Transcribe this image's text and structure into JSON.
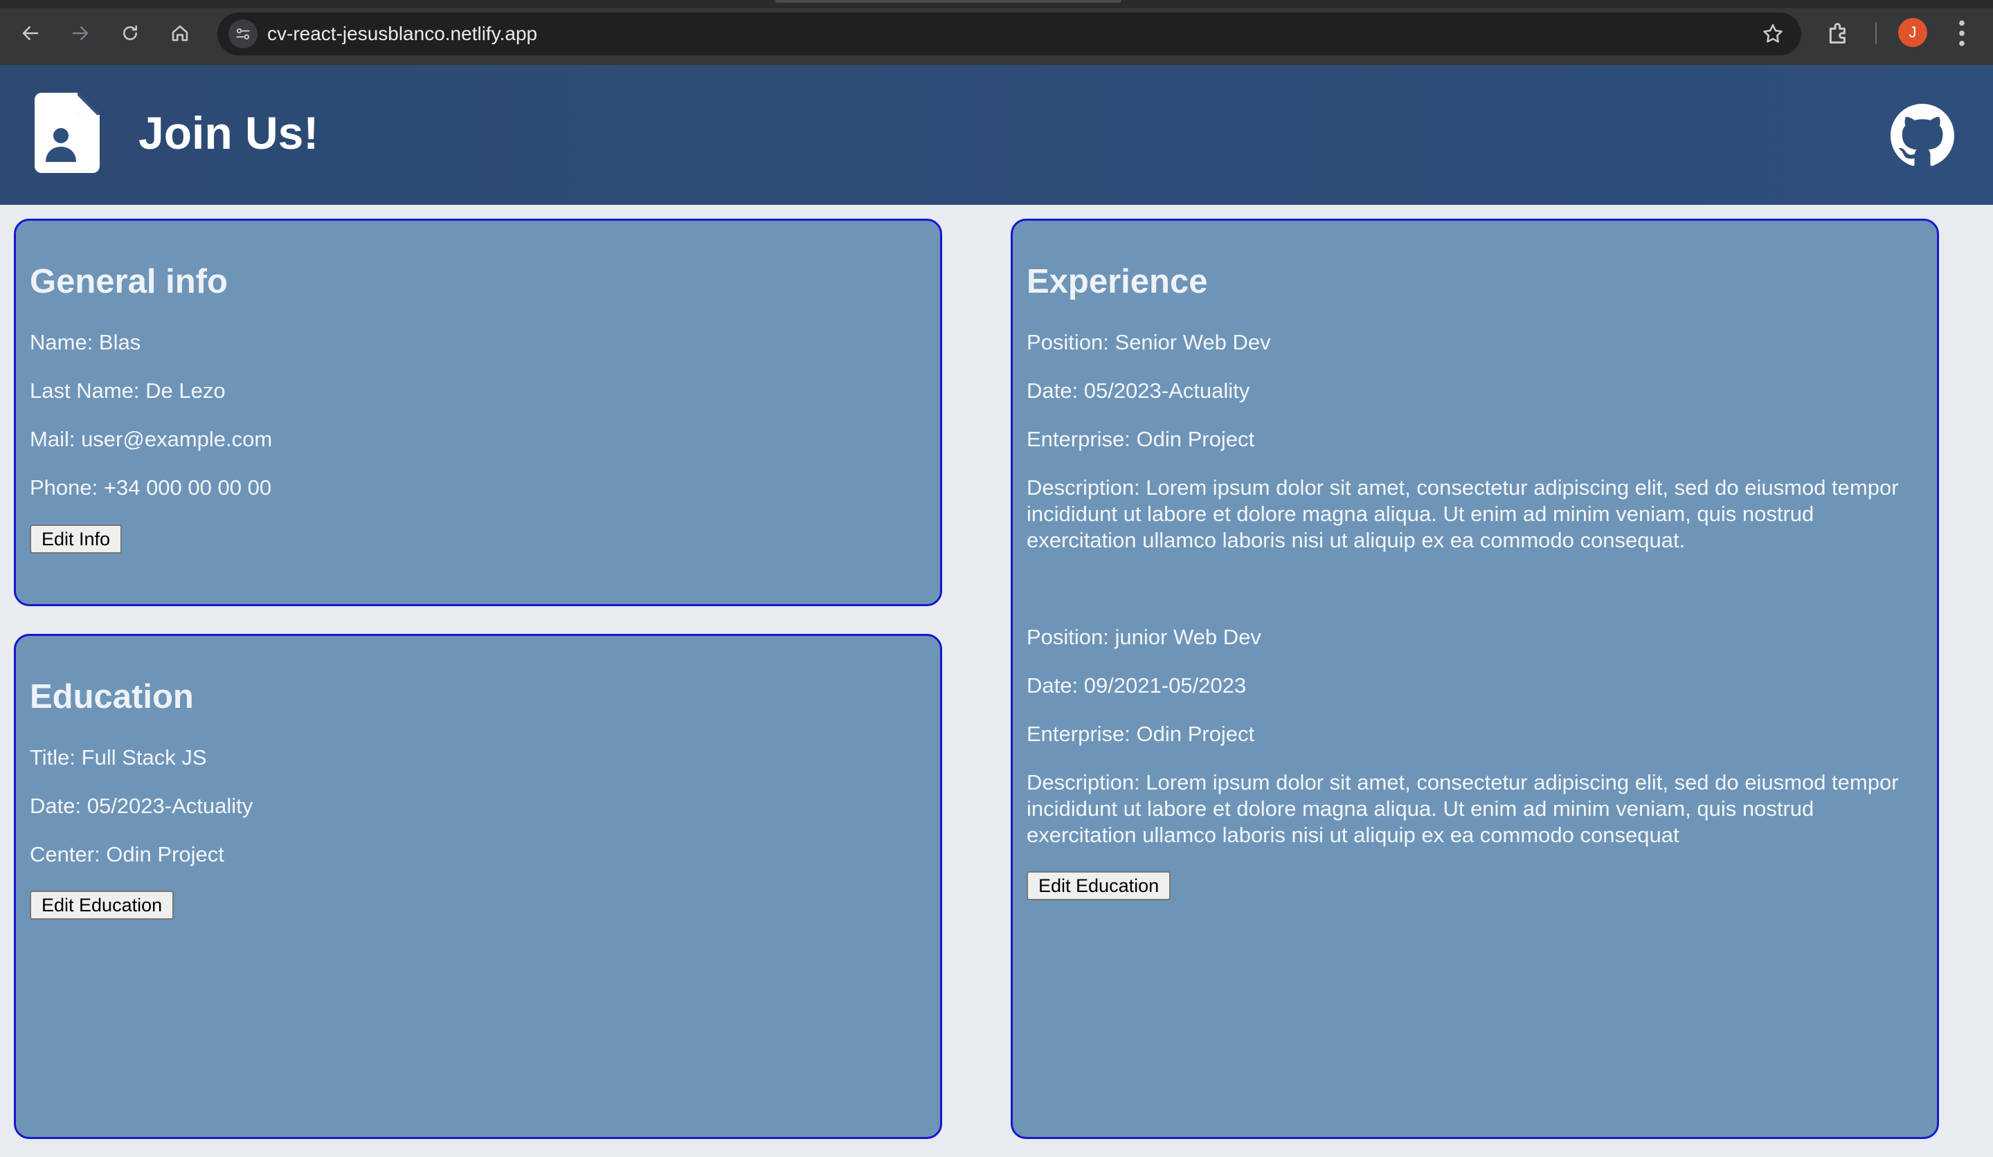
{
  "browser": {
    "url": "cv-react-jesusblanco.netlify.app",
    "profile_initial": "J",
    "icons": [
      "back-icon",
      "forward-icon",
      "reload-icon",
      "home-icon",
      "site-info-icon",
      "bookmark-star-icon",
      "extensions-icon",
      "kebab-menu-icon"
    ]
  },
  "header": {
    "title": "Join Us!",
    "logo_icon": "resume-file-icon",
    "github_icon": "github-icon"
  },
  "general": {
    "heading": "General info",
    "name": "Name: Blas",
    "last_name": "Last Name: De Lezo",
    "mail": "Mail: user@example.com",
    "phone": "Phone: +34 000 00 00 00",
    "button": "Edit Info"
  },
  "education": {
    "heading": "Education",
    "title": "Title: Full Stack JS",
    "date": "Date: 05/2023-Actuality",
    "center": "Center: Odin Project",
    "button": "Edit Education"
  },
  "experience": {
    "heading": "Experience",
    "jobs": [
      {
        "position": "Position: Senior Web Dev",
        "date": "Date: 05/2023-Actuality",
        "enterprise": "Enterprise: Odin Project",
        "description": "Description: Lorem ipsum dolor sit amet, consectetur adipiscing elit, sed do eiusmod tempor incididunt ut labore et dolore magna aliqua. Ut enim ad minim veniam, quis nostrud exercitation ullamco laboris nisi ut aliquip ex ea commodo consequat."
      },
      {
        "position": "Position: junior Web Dev",
        "date": "Date: 09/2021-05/2023",
        "enterprise": "Enterprise: Odin Project",
        "description": "Description: Lorem ipsum dolor sit amet, consectetur adipiscing elit, sed do eiusmod tempor incididunt ut labore et dolore magna aliqua. Ut enim ad minim veniam, quis nostrud exercitation ullamco laboris nisi ut aliquip ex ea commodo consequat"
      }
    ],
    "button": "Edit Education"
  },
  "colors": {
    "header": "#2f4f7b",
    "card_bg": "#6e95b8",
    "card_border": "#1717cf",
    "page_bg": "#e8ebef"
  }
}
